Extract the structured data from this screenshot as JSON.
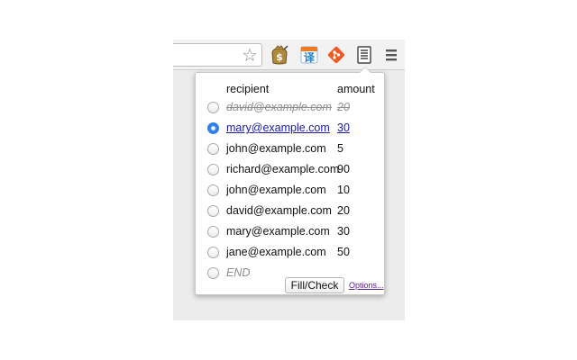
{
  "toolbar": {
    "icons": [
      "bookmark-star-icon",
      "money-extension-icon",
      "translate-extension-icon",
      "git-extension-icon",
      "list-extension-icon",
      "hamburger-menu-icon"
    ],
    "translate_label": "译",
    "colors": {
      "translate": "#1a7fd1",
      "git": "#f05a22",
      "money": "#8a6a2c"
    }
  },
  "popup": {
    "headers": {
      "recipient": "recipient",
      "amount": "amount"
    },
    "rows": [
      {
        "email": "david@example.com",
        "amount": "20",
        "state": "done"
      },
      {
        "email": "mary@example.com",
        "amount": "30",
        "state": "current"
      },
      {
        "email": "john@example.com",
        "amount": "5",
        "state": "pending"
      },
      {
        "email": "richard@example.com",
        "amount": "90",
        "state": "pending"
      },
      {
        "email": "john@example.com",
        "amount": "10",
        "state": "pending"
      },
      {
        "email": "david@example.com",
        "amount": "20",
        "state": "pending"
      },
      {
        "email": "mary@example.com",
        "amount": "30",
        "state": "pending"
      },
      {
        "email": "jane@example.com",
        "amount": "50",
        "state": "pending"
      },
      {
        "email": "END",
        "amount": "",
        "state": "end"
      }
    ],
    "fill_button": "Fill/Check",
    "options_link": "Options..."
  }
}
